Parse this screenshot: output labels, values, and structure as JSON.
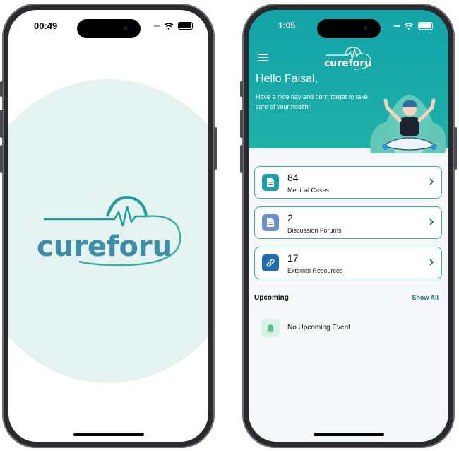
{
  "left_phone": {
    "status_time": "00:49",
    "logo_text": "cureforu"
  },
  "right_phone": {
    "status_time": "1:05",
    "header": {
      "logo_text": "cureforu",
      "greeting": "Hello Faisal,",
      "subtitle": "Have a nice day and don't forget to take care of your health!"
    },
    "cards": [
      {
        "count": "84",
        "label": "Medical Cases",
        "icon": "document-icon",
        "color": "#1aa0a6"
      },
      {
        "count": "2",
        "label": "Discussion Forums",
        "icon": "document-icon",
        "color": "#6c8fc7"
      },
      {
        "count": "17",
        "label": "External Resources",
        "icon": "link-icon",
        "color": "#1d6fb0"
      }
    ],
    "upcoming": {
      "title": "Upcoming",
      "show_all": "Show All",
      "empty_text": "No Upcoming Event"
    }
  },
  "colors": {
    "brand_teal": "#1aa8a8",
    "splash_bg": "#e4f3ef"
  }
}
